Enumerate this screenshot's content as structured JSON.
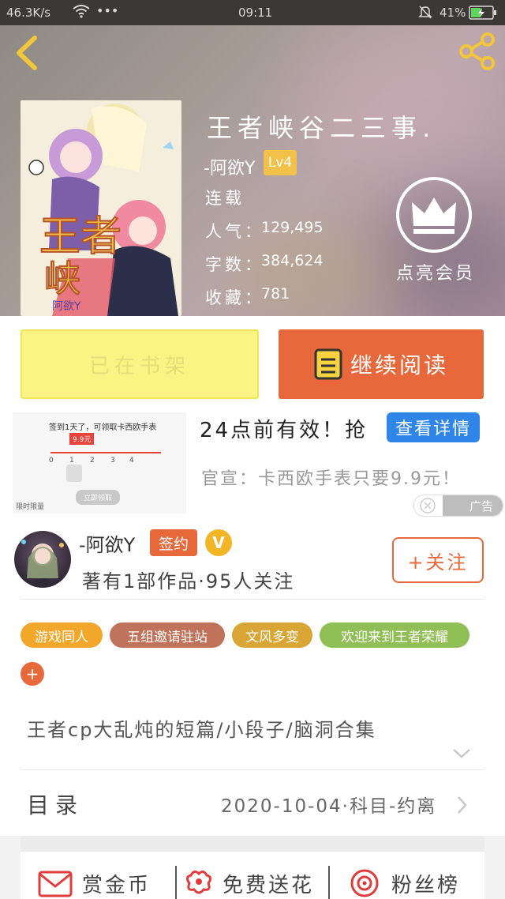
{
  "status_bar": {
    "network_speed": "46.3K/s",
    "dots": "•••",
    "time": "09:11",
    "battery": "41%"
  },
  "book": {
    "title": "王者峡谷二三事.",
    "author": "-阿欲Y",
    "level": "Lv4",
    "status": "连载",
    "popularity_label": "人气：",
    "popularity_value": "129,495",
    "word_count_label": "字数：",
    "word_count_value": "384,624",
    "favorites_label": "收藏：",
    "favorites_value": "781",
    "cover_caption": "阿欲Y"
  },
  "membership": {
    "label": "点亮会员"
  },
  "actions": {
    "shelf_label": "已在书架",
    "continue_label": "继续阅读"
  },
  "ad": {
    "image_headline": "签到1天了，可领取卡西欧手表",
    "image_price": "9.9元",
    "image_steps": [
      "0",
      "1",
      "2",
      "3",
      "4"
    ],
    "image_button": "立即领取",
    "image_footer": "限时限量",
    "title": "24点前有效！抢",
    "detail_button": "查看详情",
    "description": "官宣：卡西欧手表只要9.9元！",
    "badge_label": "广告"
  },
  "author": {
    "name": "-阿欲Y",
    "sign_tag": "签约",
    "vip_mark": "V",
    "stats": "著有1部作品·95人关注",
    "follow_label": "+关注"
  },
  "tags": [
    {
      "label": "游戏同人",
      "color": "#f2a72a"
    },
    {
      "label": "五组邀请驻站",
      "color": "#c0735a"
    },
    {
      "label": "文风多变",
      "color": "#d9a534"
    },
    {
      "label": "欢迎来到王者荣耀",
      "color": "#8fbf55"
    }
  ],
  "tag_add": "+",
  "description": "王者cp大乱炖的短篇/小段子/脑洞合集",
  "toc": {
    "label": "目录",
    "latest": "2020-10-04·科目-约离"
  },
  "bottom_actions": {
    "reward": "赏金币",
    "flowers": "免费送花",
    "fans": "粉丝榜"
  },
  "colors": {
    "accent": "#e7683b",
    "shelf_bg": "#fbf383",
    "ad_button": "#2f86e8"
  }
}
